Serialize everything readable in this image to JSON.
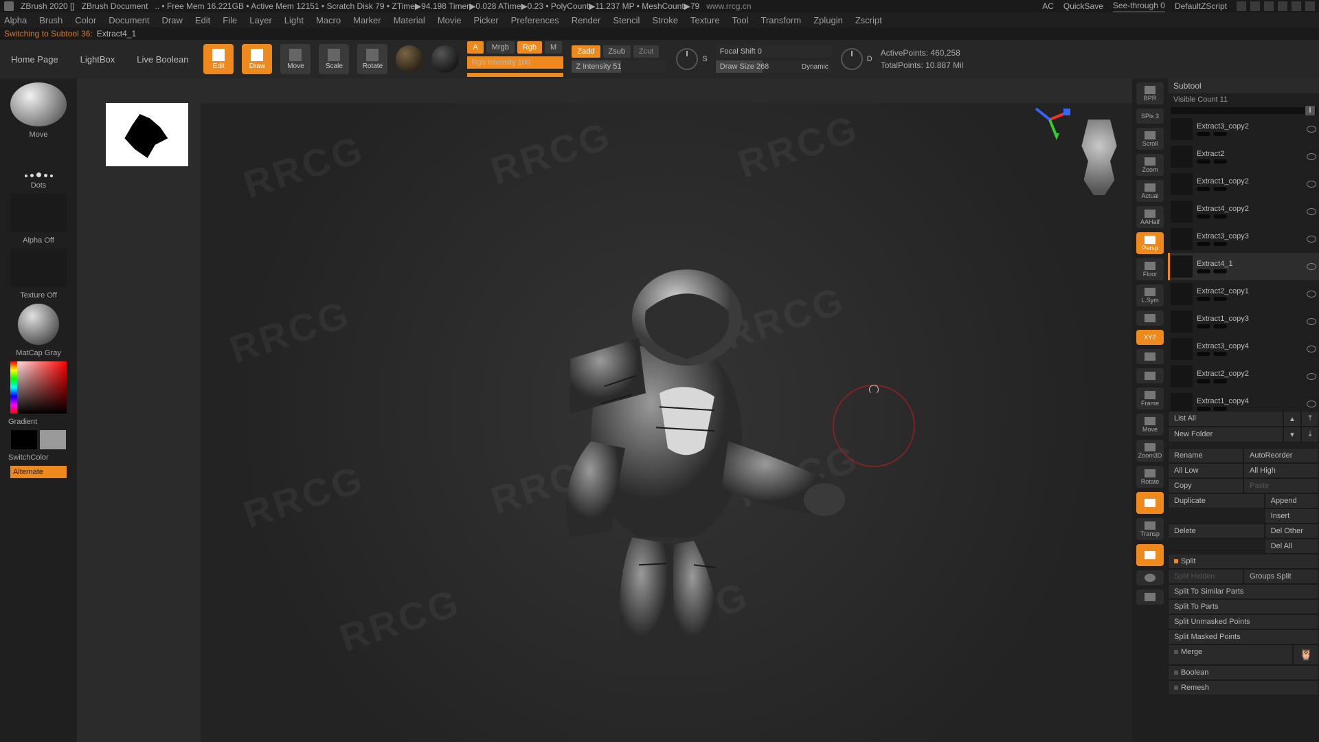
{
  "titlebar": {
    "app": "ZBrush 2020 []",
    "doc": "ZBrush Document",
    "stats": ".. • Free Mem 16.221GB • Active Mem 12151 • Scratch Disk 79 • ZTime▶94.198 Timer▶0.028 ATime▶0.23 • PolyCount▶11.237 MP • MeshCount▶79",
    "watermark_url": "www.rrcg.cn",
    "ac": "AC",
    "quicksave": "QuickSave",
    "seethrough": "See-through  0",
    "defaultscript": "DefaultZScript"
  },
  "menu": [
    "Alpha",
    "Brush",
    "Color",
    "Document",
    "Draw",
    "Edit",
    "File",
    "Layer",
    "Light",
    "Macro",
    "Marker",
    "Material",
    "Movie",
    "Picker",
    "Preferences",
    "Render",
    "Stencil",
    "Stroke",
    "Texture",
    "Tool",
    "Transform",
    "Zplugin",
    "Zscript"
  ],
  "status": {
    "prefix": "Switching to Subtool 36:",
    "name": "Extract4_1"
  },
  "shelf": {
    "home": "Home Page",
    "lightbox": "LightBox",
    "livebool": "Live Boolean",
    "mode": [
      "Edit",
      "Draw",
      "Move",
      "Scale",
      "Rotate"
    ],
    "rgbA": "A",
    "mrgb": "Mrgb",
    "rgb": "Rgb",
    "m": "M",
    "rgbint": "Rgb Intensity  100",
    "zadd": "Zadd",
    "zsub": "Zsub",
    "zcut": "Zcut",
    "zint": "Z Intensity  51",
    "focal": "Focal Shift 0",
    "drawsize": "Draw Size  268",
    "dynamic": "Dynamic",
    "s_label": "S",
    "d_label": "D",
    "active": "ActivePoints: 460,258",
    "total": "TotalPoints: 10.887 Mil"
  },
  "left": {
    "brush": "Move",
    "stroke": "Dots",
    "alpha": "Alpha Off",
    "texture": "Texture Off",
    "matcap": "MatCap Gray",
    "gradient": "Gradient",
    "switch": "SwitchColor",
    "alternate": "Alternate"
  },
  "nav": [
    "BPR",
    "SPix 3",
    "Scroll",
    "Zoom",
    "Actual",
    "AAHalf",
    "Persp",
    "Floor",
    "L.Sym",
    "XYZ",
    "Frame",
    "Move",
    "Zoom3D",
    "Rotate",
    "Transp"
  ],
  "right": {
    "subtool_hdr": "Subtool",
    "visible": "Visible Count  11",
    "items": [
      {
        "name": "Extract3_copy2"
      },
      {
        "name": "Extract2"
      },
      {
        "name": "Extract1_copy2"
      },
      {
        "name": "Extract4_copy2"
      },
      {
        "name": "Extract3_copy3"
      },
      {
        "name": "Extract4_1",
        "sel": true
      },
      {
        "name": "Extract2_copy1"
      },
      {
        "name": "Extract1_copy3"
      },
      {
        "name": "Extract3_copy4"
      },
      {
        "name": "Extract2_copy2"
      },
      {
        "name": "Extract1_copy4"
      }
    ],
    "listall": "List All",
    "newfolder": "New Folder",
    "rename": "Rename",
    "autoreorder": "AutoReorder",
    "alllow": "All Low",
    "allhigh": "All High",
    "copy": "Copy",
    "paste": "Paste",
    "duplicate": "Duplicate",
    "append": "Append",
    "insert": "Insert",
    "delete": "Delete",
    "delother": "Del Other",
    "delall": "Del All",
    "split": "Split",
    "splithidden": "Split Hidden",
    "groupssplit": "Groups Split",
    "splitsimilar": "Split To Similar Parts",
    "splitparts": "Split To Parts",
    "splitunmasked": "Split Unmasked Points",
    "splitmasked": "Split Masked Points",
    "merge": "Merge",
    "boolean": "Boolean",
    "remesh": "Remesh"
  }
}
